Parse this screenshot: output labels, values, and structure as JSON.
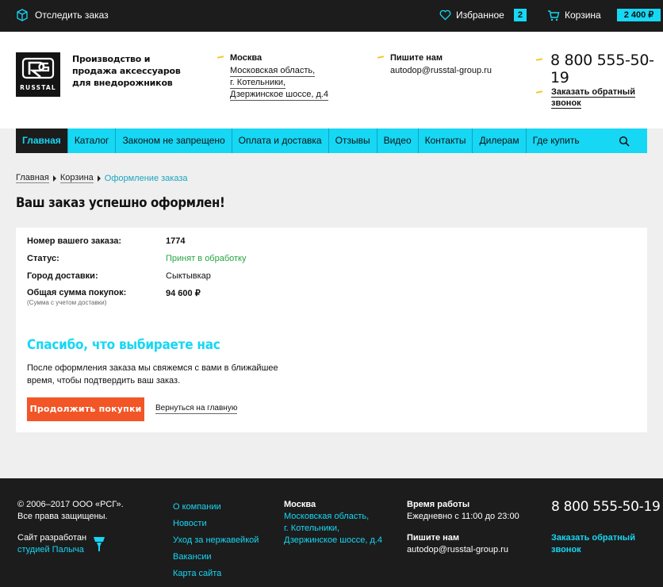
{
  "topbar": {
    "track_label": "Отследить заказ",
    "favorites_label": "Избранное",
    "favorites_count": "2",
    "cart_label": "Корзина",
    "cart_total": "2 400 ₽"
  },
  "header": {
    "logo_word": "RUSSTAL",
    "tagline": "Производство и продажа аксессуаров для внедорожников",
    "city": "Москва",
    "address_lines": [
      "Московская область,",
      "г. Котельники,",
      "Дзержинское шоссе, д.4"
    ],
    "mail_label": "Пишите нам",
    "email": "autodop@russtal-group.ru",
    "phone": "8 800 555-50-19",
    "callback_line1": "Заказать обратный",
    "callback_line2": "звонок"
  },
  "nav": {
    "items": [
      "Главная",
      "Каталог",
      "Законом не запрещено",
      "Оплата и доставка",
      "Отзывы",
      "Видео",
      "Контакты",
      "Дилерам",
      "Где купить"
    ]
  },
  "breadcrumbs": [
    "Главная",
    "Корзина",
    "Оформление заказа"
  ],
  "page_title": "Ваш заказ успешно оформлен!",
  "order": {
    "number_label": "Номер вашего заказа:",
    "number_value": "1774",
    "status_label": "Статус:",
    "status_value": "Принят в обработку",
    "city_label": "Город доставки:",
    "city_value": "Сыктывкар",
    "sum_label": "Общая сумма покупок:",
    "sum_value": "94 600 ₽",
    "sum_note": "(Сумма с учетом доставки)"
  },
  "thanks": {
    "title": "Спасибо, что выбираете нас",
    "text": "После оформления заказа мы свяжемся с вами в ближайшее время, чтобы подтвердить ваш заказ.",
    "continue_button": "Продолжить покупки",
    "back_link": "Вернуться на главную"
  },
  "footer": {
    "copy_line1": "© 2006–2017 ООО «РСГ».",
    "copy_line2": "Все права защищены.",
    "dev_line1": "Сайт разработан",
    "dev_link": "студией Палыча",
    "links": [
      "О компании",
      "Новости",
      "Уход за нержавейкой",
      "Вакансии",
      "Карта сайта"
    ],
    "city": "Москва",
    "address_lines": [
      "Московская область,",
      "г. Котельники,",
      "Дзержинское шоссе, д.4"
    ],
    "hours_label": "Время работы",
    "hours_value": "Ежедневно с 11:00 до 23:00",
    "mail_label": "Пишите нам",
    "email": "autodop@russtal-group.ru",
    "phone": "8 800 555-50-19",
    "callback_line1": "Заказать обратный",
    "callback_line2": "звонок"
  },
  "colors": {
    "accent": "#16d7f4",
    "button": "#f25526",
    "dark": "#1c1c1c",
    "highlight": "#f3c623",
    "status_green": "#25a541"
  }
}
